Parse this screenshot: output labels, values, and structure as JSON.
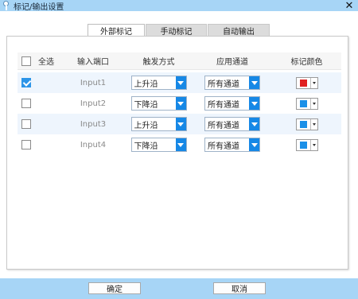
{
  "window": {
    "title": "标记/输出设置",
    "close_icon": "close-icon"
  },
  "tabs": [
    {
      "label": "外部标记",
      "active": true
    },
    {
      "label": "手动标记",
      "active": false
    },
    {
      "label": "自动输出",
      "active": false
    }
  ],
  "table": {
    "headers": {
      "select_all": "全选",
      "port": "输入端口",
      "trigger": "触发方式",
      "channel": "应用通道",
      "color": "标记颜色"
    },
    "select_all_checked": false,
    "rows": [
      {
        "checked": true,
        "port": "Input1",
        "trigger": "上升沿",
        "channel": "所有通道",
        "color": "#e02020"
      },
      {
        "checked": false,
        "port": "Input2",
        "trigger": "下降沿",
        "channel": "所有通道",
        "color": "#1a90e8"
      },
      {
        "checked": false,
        "port": "Input3",
        "trigger": "上升沿",
        "channel": "所有通道",
        "color": "#1a90e8"
      },
      {
        "checked": false,
        "port": "Input4",
        "trigger": "下降沿",
        "channel": "所有通道",
        "color": "#1a90e8"
      }
    ]
  },
  "footer": {
    "ok_label": "确定",
    "cancel_label": "取消"
  }
}
